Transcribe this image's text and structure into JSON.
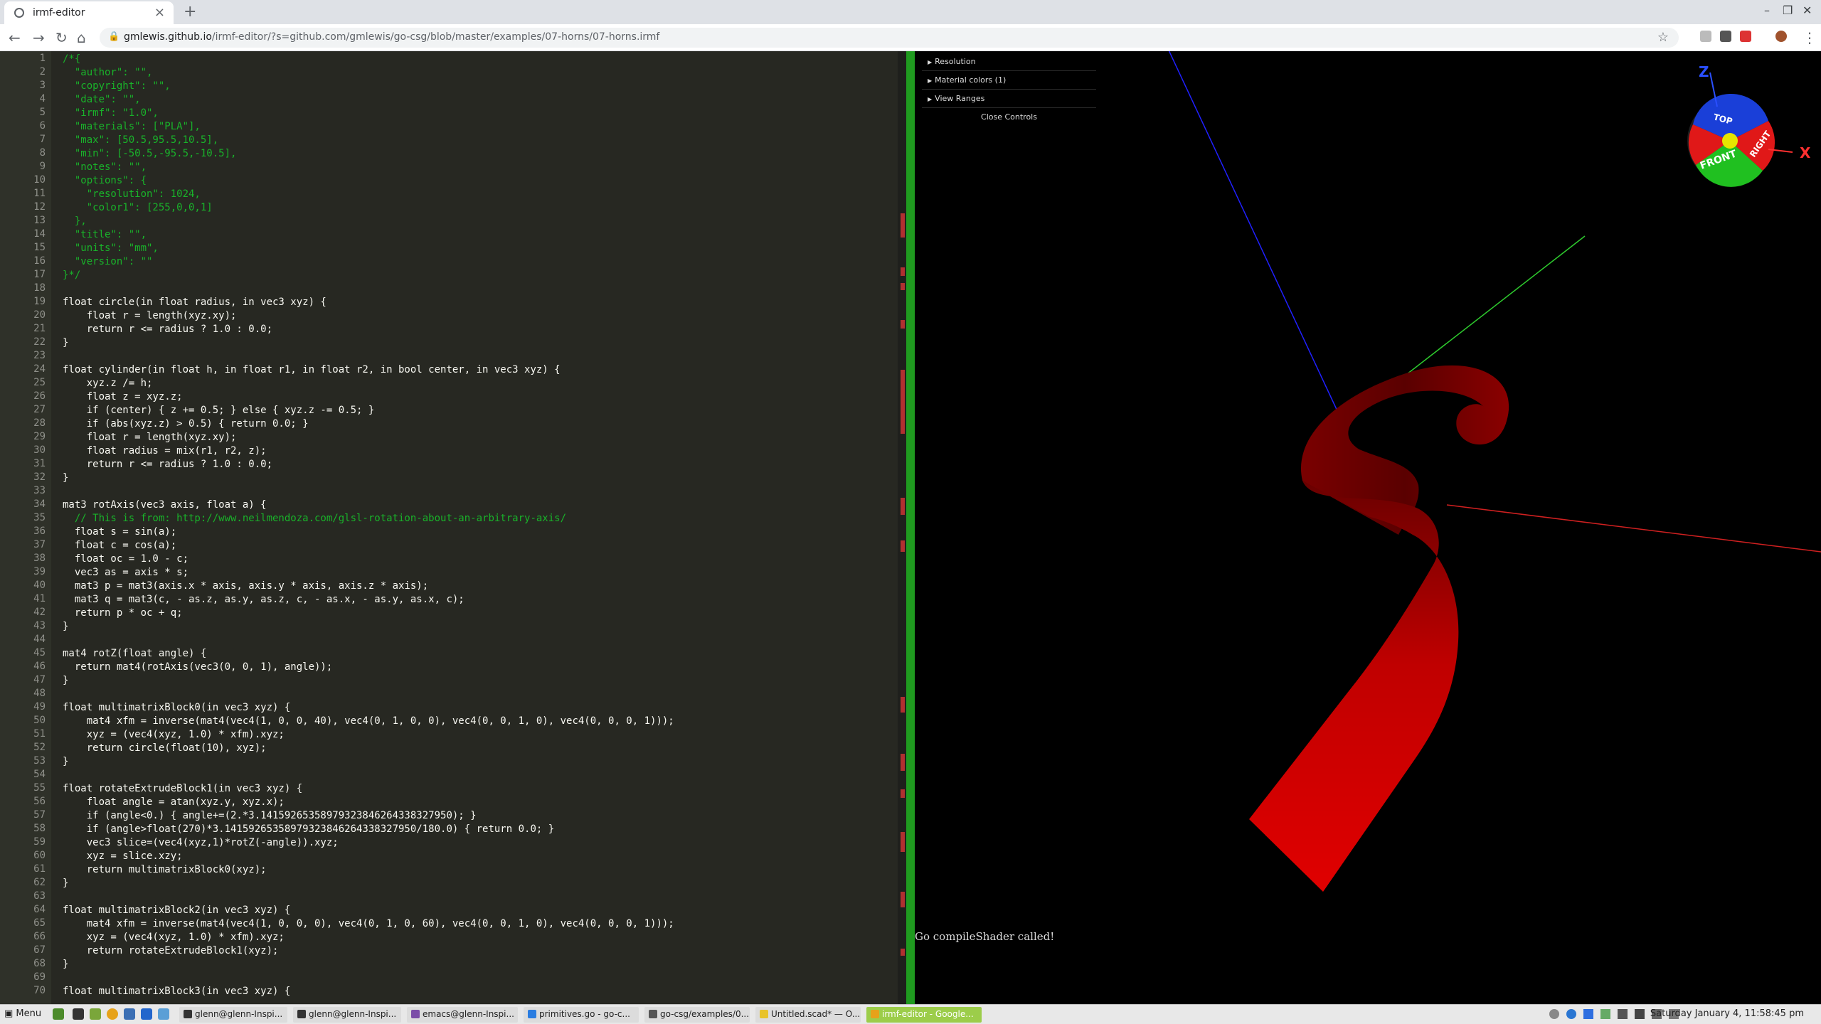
{
  "browser": {
    "tab_title": "irmf-editor",
    "url_host": "gmlewis.github.io",
    "url_path": "/irmf-editor/?s=github.com/gmlewis/go-csg/blob/master/examples/07-horns/07-horns.irmf"
  },
  "editor": {
    "lines": [
      {
        "t": "/*{",
        "c": "comment"
      },
      {
        "t": "  \"author\": \"\",",
        "c": "comment"
      },
      {
        "t": "  \"copyright\": \"\",",
        "c": "comment"
      },
      {
        "t": "  \"date\": \"\",",
        "c": "comment"
      },
      {
        "t": "  \"irmf\": \"1.0\",",
        "c": "comment"
      },
      {
        "t": "  \"materials\": [\"PLA\"],",
        "c": "comment"
      },
      {
        "t": "  \"max\": [50.5,95.5,10.5],",
        "c": "comment"
      },
      {
        "t": "  \"min\": [-50.5,-95.5,-10.5],",
        "c": "comment"
      },
      {
        "t": "  \"notes\": \"\",",
        "c": "comment"
      },
      {
        "t": "  \"options\": {",
        "c": "comment"
      },
      {
        "t": "    \"resolution\": 1024,",
        "c": "comment"
      },
      {
        "t": "    \"color1\": [255,0,0,1]",
        "c": "comment"
      },
      {
        "t": "  },",
        "c": "comment"
      },
      {
        "t": "  \"title\": \"\",",
        "c": "comment"
      },
      {
        "t": "  \"units\": \"mm\",",
        "c": "comment"
      },
      {
        "t": "  \"version\": \"\"",
        "c": "comment"
      },
      {
        "t": "}*/",
        "c": "comment"
      },
      {
        "t": "",
        "c": ""
      },
      {
        "t": "float circle(in float radius, in vec3 xyz) {",
        "c": ""
      },
      {
        "t": "    float r = length(xyz.xy);",
        "c": ""
      },
      {
        "t": "    return r <= radius ? 1.0 : 0.0;",
        "c": ""
      },
      {
        "t": "}",
        "c": ""
      },
      {
        "t": "",
        "c": ""
      },
      {
        "t": "float cylinder(in float h, in float r1, in float r2, in bool center, in vec3 xyz) {",
        "c": ""
      },
      {
        "t": "    xyz.z /= h;",
        "c": ""
      },
      {
        "t": "    float z = xyz.z;",
        "c": ""
      },
      {
        "t": "    if (center) { z += 0.5; } else { xyz.z -= 0.5; }",
        "c": ""
      },
      {
        "t": "    if (abs(xyz.z) > 0.5) { return 0.0; }",
        "c": ""
      },
      {
        "t": "    float r = length(xyz.xy);",
        "c": ""
      },
      {
        "t": "    float radius = mix(r1, r2, z);",
        "c": ""
      },
      {
        "t": "    return r <= radius ? 1.0 : 0.0;",
        "c": ""
      },
      {
        "t": "}",
        "c": ""
      },
      {
        "t": "",
        "c": ""
      },
      {
        "t": "mat3 rotAxis(vec3 axis, float a) {",
        "c": ""
      },
      {
        "t": "  // This is from: http://www.neilmendoza.com/glsl-rotation-about-an-arbitrary-axis/",
        "c": "comment"
      },
      {
        "t": "  float s = sin(a);",
        "c": ""
      },
      {
        "t": "  float c = cos(a);",
        "c": ""
      },
      {
        "t": "  float oc = 1.0 - c;",
        "c": ""
      },
      {
        "t": "  vec3 as = axis * s;",
        "c": ""
      },
      {
        "t": "  mat3 p = mat3(axis.x * axis, axis.y * axis, axis.z * axis);",
        "c": ""
      },
      {
        "t": "  mat3 q = mat3(c, - as.z, as.y, as.z, c, - as.x, - as.y, as.x, c);",
        "c": ""
      },
      {
        "t": "  return p * oc + q;",
        "c": ""
      },
      {
        "t": "}",
        "c": ""
      },
      {
        "t": "",
        "c": ""
      },
      {
        "t": "mat4 rotZ(float angle) {",
        "c": ""
      },
      {
        "t": "  return mat4(rotAxis(vec3(0, 0, 1), angle));",
        "c": ""
      },
      {
        "t": "}",
        "c": ""
      },
      {
        "t": "",
        "c": ""
      },
      {
        "t": "float multimatrixBlock0(in vec3 xyz) {",
        "c": ""
      },
      {
        "t": "    mat4 xfm = inverse(mat4(vec4(1, 0, 0, 40), vec4(0, 1, 0, 0), vec4(0, 0, 1, 0), vec4(0, 0, 0, 1)));",
        "c": ""
      },
      {
        "t": "    xyz = (vec4(xyz, 1.0) * xfm).xyz;",
        "c": ""
      },
      {
        "t": "    return circle(float(10), xyz);",
        "c": ""
      },
      {
        "t": "}",
        "c": ""
      },
      {
        "t": "",
        "c": ""
      },
      {
        "t": "float rotateExtrudeBlock1(in vec3 xyz) {",
        "c": ""
      },
      {
        "t": "    float angle = atan(xyz.y, xyz.x);",
        "c": ""
      },
      {
        "t": "    if (angle<0.) { angle+=(2.*3.14159265358979323846264338327950); }",
        "c": ""
      },
      {
        "t": "    if (angle>float(270)*3.14159265358979323846264338327950/180.0) { return 0.0; }",
        "c": ""
      },
      {
        "t": "    vec3 slice=(vec4(xyz,1)*rotZ(-angle)).xyz;",
        "c": ""
      },
      {
        "t": "    xyz = slice.xzy;",
        "c": ""
      },
      {
        "t": "    return multimatrixBlock0(xyz);",
        "c": ""
      },
      {
        "t": "}",
        "c": ""
      },
      {
        "t": "",
        "c": ""
      },
      {
        "t": "float multimatrixBlock2(in vec3 xyz) {",
        "c": ""
      },
      {
        "t": "    mat4 xfm = inverse(mat4(vec4(1, 0, 0, 0), vec4(0, 1, 0, 60), vec4(0, 0, 1, 0), vec4(0, 0, 0, 1)));",
        "c": ""
      },
      {
        "t": "    xyz = (vec4(xyz, 1.0) * xfm).xyz;",
        "c": ""
      },
      {
        "t": "    return rotateExtrudeBlock1(xyz);",
        "c": ""
      },
      {
        "t": "}",
        "c": ""
      },
      {
        "t": "",
        "c": ""
      },
      {
        "t": "float multimatrixBlock3(in vec3 xyz) {",
        "c": ""
      }
    ]
  },
  "viewer": {
    "controls": [
      "Resolution",
      "Material colors (1)",
      "View Ranges"
    ],
    "close_label": "Close Controls",
    "status": "Go compileShader called!",
    "axis_labels": {
      "x": "X",
      "z": "Z"
    }
  },
  "taskbar": {
    "menu_label": "Menu",
    "windows": [
      "glenn@glenn-Inspi...",
      "glenn@glenn-Inspi...",
      "emacs@glenn-Inspi...",
      "primitives.go - go-c...",
      "go-csg/examples/0...",
      "Untitled.scad* — O...",
      "irmf-editor - Google..."
    ],
    "clock": "Saturday January 4, 11:58:45 pm"
  }
}
